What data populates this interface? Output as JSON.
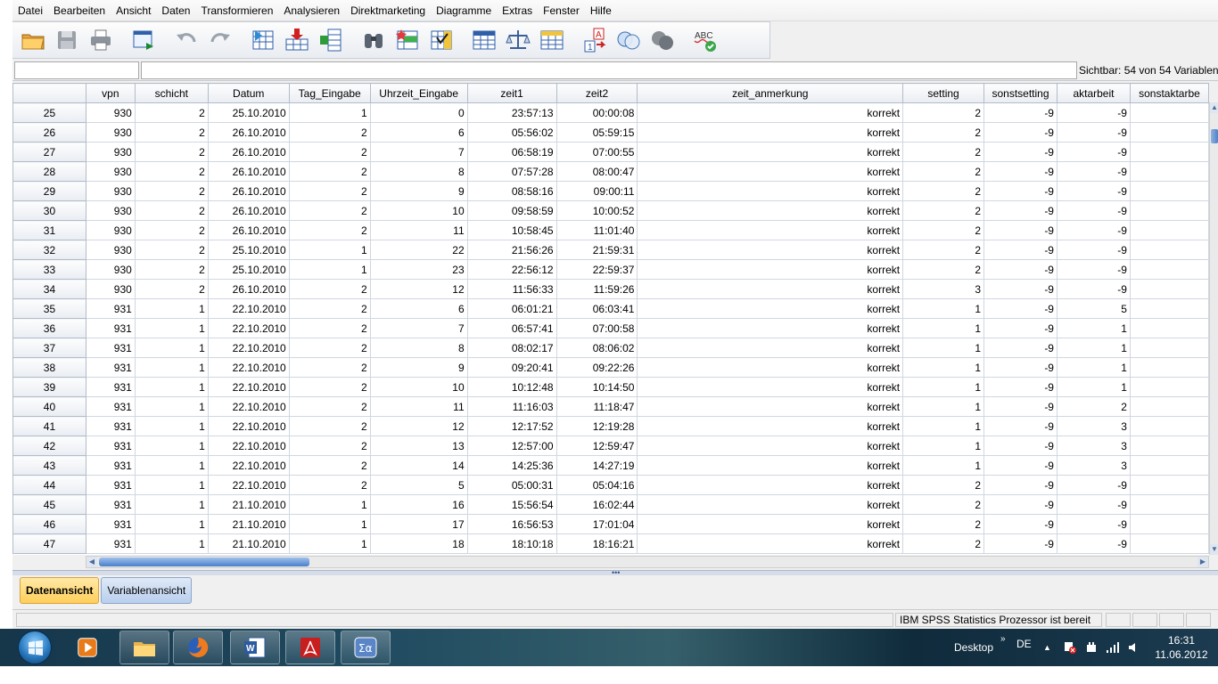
{
  "menu": [
    "Datei",
    "Bearbeiten",
    "Ansicht",
    "Daten",
    "Transformieren",
    "Analysieren",
    "Direktmarketing",
    "Diagramme",
    "Extras",
    "Fenster",
    "Hilfe"
  ],
  "toolbar_icons": [
    "open-folder-icon",
    "save-disk-icon",
    "print-icon",
    "recall-dialog-icon",
    "undo-icon",
    "redo-icon",
    "goto-case-icon",
    "goto-variable-icon",
    "variables-icon",
    "find-binoculars-icon",
    "insert-cases-icon",
    "insert-variable-icon",
    "split-file-icon",
    "weight-cases-icon",
    "select-cases-icon",
    "value-labels-icon",
    "use-sets-icon",
    "show-all-variables-icon",
    "spell-check-icon"
  ],
  "visible_info": "Sichtbar: 54 von 54 Variablen",
  "grid": {
    "columns": [
      "vpn",
      "schicht",
      "Datum",
      "Tag_Eingabe",
      "Uhrzeit_Eingabe",
      "zeit1",
      "zeit2",
      "zeit_anmerkung",
      "setting",
      "sonstsetting",
      "aktarbeit",
      "sonstaktarbe"
    ],
    "rows": [
      {
        "n": "25",
        "c": [
          "930",
          "2",
          "25.10.2010",
          "1",
          "0",
          "23:57:13",
          "00:00:08",
          "korrekt",
          "2",
          "-9",
          "-9",
          ""
        ]
      },
      {
        "n": "26",
        "c": [
          "930",
          "2",
          "26.10.2010",
          "2",
          "6",
          "05:56:02",
          "05:59:15",
          "korrekt",
          "2",
          "-9",
          "-9",
          ""
        ]
      },
      {
        "n": "27",
        "c": [
          "930",
          "2",
          "26.10.2010",
          "2",
          "7",
          "06:58:19",
          "07:00:55",
          "korrekt",
          "2",
          "-9",
          "-9",
          ""
        ]
      },
      {
        "n": "28",
        "c": [
          "930",
          "2",
          "26.10.2010",
          "2",
          "8",
          "07:57:28",
          "08:00:47",
          "korrekt",
          "2",
          "-9",
          "-9",
          ""
        ]
      },
      {
        "n": "29",
        "c": [
          "930",
          "2",
          "26.10.2010",
          "2",
          "9",
          "08:58:16",
          "09:00:11",
          "korrekt",
          "2",
          "-9",
          "-9",
          ""
        ]
      },
      {
        "n": "30",
        "c": [
          "930",
          "2",
          "26.10.2010",
          "2",
          "10",
          "09:58:59",
          "10:00:52",
          "korrekt",
          "2",
          "-9",
          "-9",
          ""
        ]
      },
      {
        "n": "31",
        "c": [
          "930",
          "2",
          "26.10.2010",
          "2",
          "11",
          "10:58:45",
          "11:01:40",
          "korrekt",
          "2",
          "-9",
          "-9",
          ""
        ]
      },
      {
        "n": "32",
        "c": [
          "930",
          "2",
          "25.10.2010",
          "1",
          "22",
          "21:56:26",
          "21:59:31",
          "korrekt",
          "2",
          "-9",
          "-9",
          ""
        ]
      },
      {
        "n": "33",
        "c": [
          "930",
          "2",
          "25.10.2010",
          "1",
          "23",
          "22:56:12",
          "22:59:37",
          "korrekt",
          "2",
          "-9",
          "-9",
          ""
        ]
      },
      {
        "n": "34",
        "c": [
          "930",
          "2",
          "26.10.2010",
          "2",
          "12",
          "11:56:33",
          "11:59:26",
          "korrekt",
          "3",
          "-9",
          "-9",
          ""
        ]
      },
      {
        "n": "35",
        "c": [
          "931",
          "1",
          "22.10.2010",
          "2",
          "6",
          "06:01:21",
          "06:03:41",
          "korrekt",
          "1",
          "-9",
          "5",
          ""
        ]
      },
      {
        "n": "36",
        "c": [
          "931",
          "1",
          "22.10.2010",
          "2",
          "7",
          "06:57:41",
          "07:00:58",
          "korrekt",
          "1",
          "-9",
          "1",
          ""
        ]
      },
      {
        "n": "37",
        "c": [
          "931",
          "1",
          "22.10.2010",
          "2",
          "8",
          "08:02:17",
          "08:06:02",
          "korrekt",
          "1",
          "-9",
          "1",
          ""
        ]
      },
      {
        "n": "38",
        "c": [
          "931",
          "1",
          "22.10.2010",
          "2",
          "9",
          "09:20:41",
          "09:22:26",
          "korrekt",
          "1",
          "-9",
          "1",
          ""
        ]
      },
      {
        "n": "39",
        "c": [
          "931",
          "1",
          "22.10.2010",
          "2",
          "10",
          "10:12:48",
          "10:14:50",
          "korrekt",
          "1",
          "-9",
          "1",
          ""
        ]
      },
      {
        "n": "40",
        "c": [
          "931",
          "1",
          "22.10.2010",
          "2",
          "11",
          "11:16:03",
          "11:18:47",
          "korrekt",
          "1",
          "-9",
          "2",
          ""
        ]
      },
      {
        "n": "41",
        "c": [
          "931",
          "1",
          "22.10.2010",
          "2",
          "12",
          "12:17:52",
          "12:19:28",
          "korrekt",
          "1",
          "-9",
          "3",
          ""
        ]
      },
      {
        "n": "42",
        "c": [
          "931",
          "1",
          "22.10.2010",
          "2",
          "13",
          "12:57:00",
          "12:59:47",
          "korrekt",
          "1",
          "-9",
          "3",
          ""
        ]
      },
      {
        "n": "43",
        "c": [
          "931",
          "1",
          "22.10.2010",
          "2",
          "14",
          "14:25:36",
          "14:27:19",
          "korrekt",
          "1",
          "-9",
          "3",
          ""
        ]
      },
      {
        "n": "44",
        "c": [
          "931",
          "1",
          "22.10.2010",
          "2",
          "5",
          "05:00:31",
          "05:04:16",
          "korrekt",
          "2",
          "-9",
          "-9",
          ""
        ]
      },
      {
        "n": "45",
        "c": [
          "931",
          "1",
          "21.10.2010",
          "1",
          "16",
          "15:56:54",
          "16:02:44",
          "korrekt",
          "2",
          "-9",
          "-9",
          ""
        ]
      },
      {
        "n": "46",
        "c": [
          "931",
          "1",
          "21.10.2010",
          "1",
          "17",
          "16:56:53",
          "17:01:04",
          "korrekt",
          "2",
          "-9",
          "-9",
          ""
        ]
      },
      {
        "n": "47",
        "c": [
          "931",
          "1",
          "21.10.2010",
          "1",
          "18",
          "18:10:18",
          "18:16:21",
          "korrekt",
          "2",
          "-9",
          "-9",
          ""
        ]
      }
    ]
  },
  "tabs": {
    "data_view": "Datenansicht",
    "variable_view": "Variablenansicht"
  },
  "status": {
    "processor": "IBM SPSS Statistics  Prozessor ist bereit"
  },
  "taskbar": {
    "desktop_label": "Desktop",
    "language": "DE",
    "time": "16:31",
    "date": "11.06.2012",
    "apps": [
      "media-player-icon",
      "file-explorer-icon",
      "firefox-icon",
      "word-icon",
      "acrobat-pdf-icon",
      "spss-statistics-icon"
    ]
  },
  "colors": {
    "active_tab": "#ffcf5a",
    "header_bg": "#e9edf3",
    "grid_line": "#d0d7e1"
  }
}
